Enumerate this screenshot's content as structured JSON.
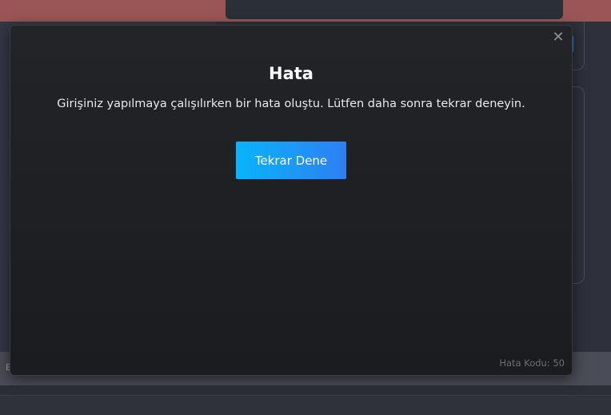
{
  "background": {
    "bottom_bar_text": "E"
  },
  "modal": {
    "title": "Hata",
    "message": "Girişiniz yapılmaya çalışılırken bir hata oluştu. Lütfen daha sonra tekrar deneyin.",
    "retry_label": "Tekrar Dene",
    "close_symbol": "✕",
    "error_code": "Hata Kodu: 50",
    "close_icon": "close-icon"
  },
  "colors": {
    "accent_start": "#08b4fb",
    "accent_end": "#2e7ff2",
    "modal_bg": "#1e1f23",
    "top_banner": "#9a5656"
  }
}
